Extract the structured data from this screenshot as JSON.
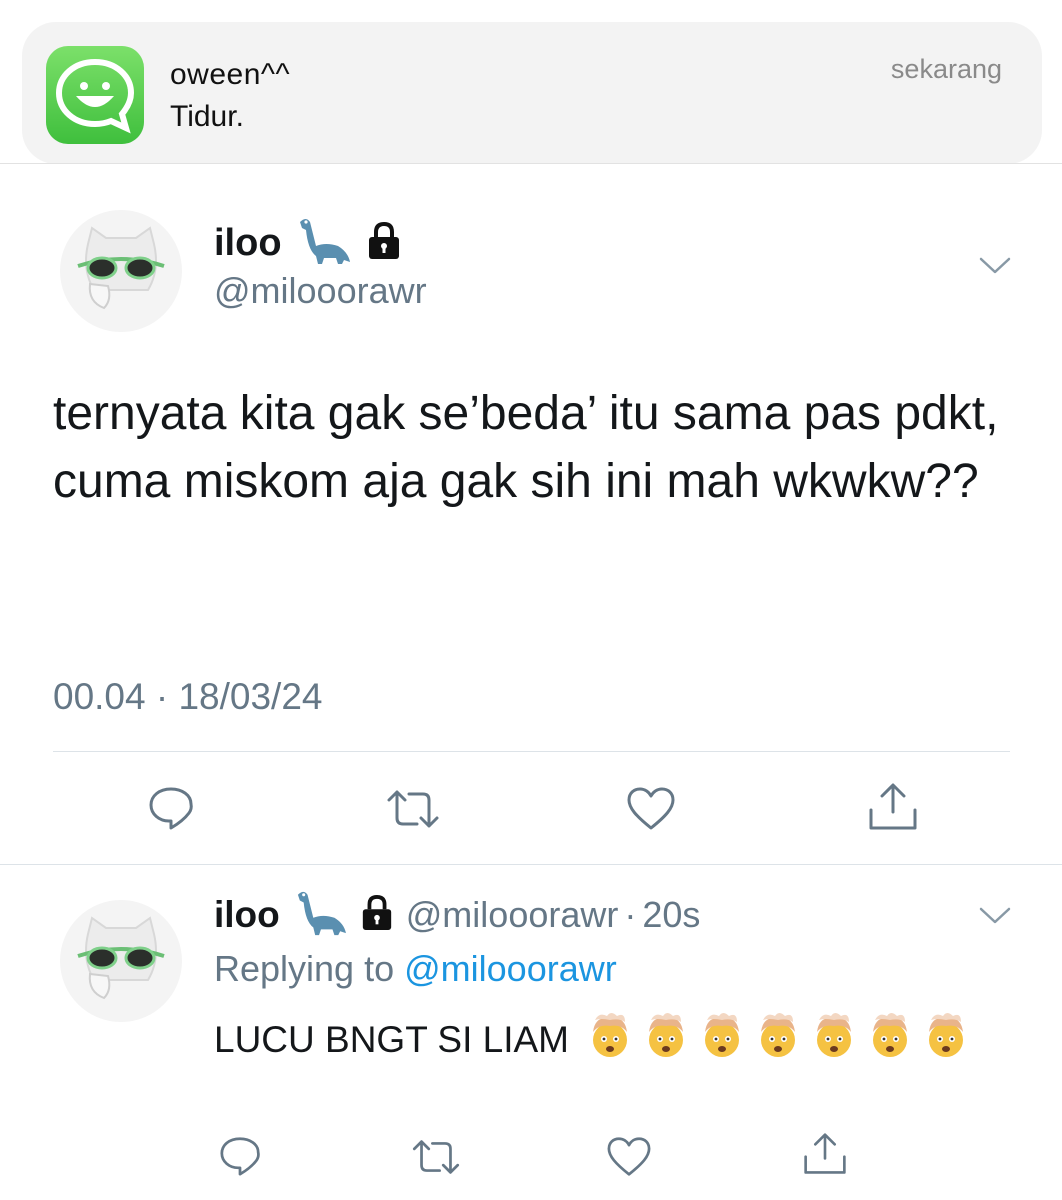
{
  "notification": {
    "app_icon": "chat-smile-icon",
    "sender": "oween^^",
    "message": "Tidur.",
    "time": "sekarang"
  },
  "tweet": {
    "display_name": "iloo",
    "name_icons": [
      "dinosaur-emoji",
      "lock-icon"
    ],
    "handle": "@milooorawr",
    "text": "ternyata kita gak se’beda’ itu sama pas pdkt, cuma miskom aja gak sih ini mah wkwkw??",
    "timestamp": "00.04 · 18/03/24",
    "actions": [
      "reply-icon",
      "retweet-icon",
      "like-icon",
      "share-icon"
    ]
  },
  "reply": {
    "display_name": "iloo",
    "handle": "@milooorawr",
    "age": "20s",
    "replying_prefix": "Replying to",
    "replying_handle": "@milooorawr",
    "text": "LUCU BNGT SI LIAM",
    "emoji_count": 7,
    "emoji_name": "exploding-head-emoji"
  },
  "colors": {
    "handle_gray": "#657786",
    "link_blue": "#1b95e0",
    "app_green": "#4cc94a"
  }
}
